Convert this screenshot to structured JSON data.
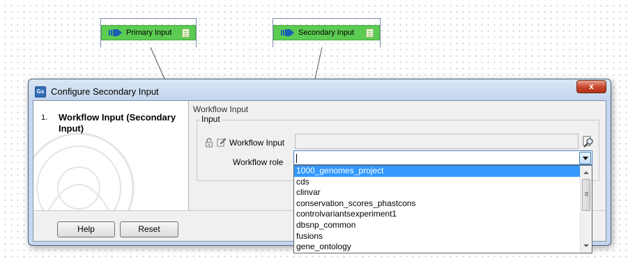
{
  "canvas": {
    "nodes": [
      {
        "label": "Primary Input",
        "icon": "input-arrow-icon"
      },
      {
        "label": "Secondary Input",
        "icon": "input-arrow-icon"
      }
    ],
    "node_color": "#5ccb52"
  },
  "dialog": {
    "app_icon_text": "Gx",
    "title": "Configure Secondary Input",
    "close_label": "x",
    "steps": [
      {
        "number": "1.",
        "label": "Workflow Input (Secondary Input)"
      }
    ],
    "section_title": "Workflow Input",
    "group_title": "Input",
    "workflow_input_label": "Workflow Input",
    "workflow_input_value": "",
    "workflow_role_label": "Workflow role",
    "workflow_role_value": "",
    "buttons": {
      "help": "Help",
      "reset": "Reset"
    }
  },
  "dropdown": {
    "selected_index": 0,
    "options": [
      "1000_genomes_project",
      "cds",
      "clinvar",
      "conservation_scores_phastcons",
      "controlvariantsexperiment1",
      "dbsnp_common",
      "fusions",
      "gene_ontology"
    ],
    "highlight_color": "#3399ff"
  }
}
